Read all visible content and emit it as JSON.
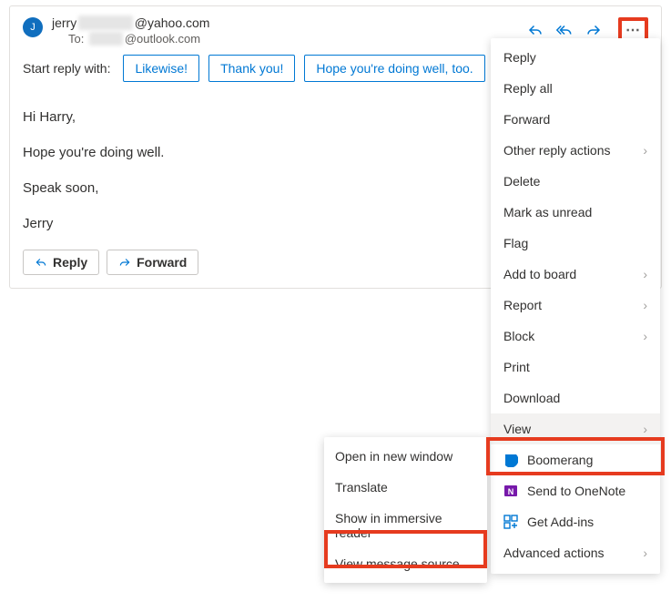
{
  "sender": {
    "avatar_initial": "J",
    "name_prefix": "jerry",
    "name_blur": "██████",
    "domain": "@yahoo.com",
    "to_label": "To:",
    "to_blur": "████",
    "to_domain": "@outlook.com"
  },
  "quick_reply": {
    "label": "Start reply with:",
    "options": [
      "Likewise!",
      "Thank you!",
      "Hope you're doing well, too."
    ]
  },
  "body": {
    "line1": "Hi Harry,",
    "line2": "Hope you're doing well.",
    "line3": "Speak soon,",
    "line4": "Jerry"
  },
  "bottom_buttons": {
    "reply": "Reply",
    "forward": "Forward"
  },
  "menu": {
    "reply": "Reply",
    "reply_all": "Reply all",
    "forward": "Forward",
    "other_reply": "Other reply actions",
    "delete": "Delete",
    "mark_unread": "Mark as unread",
    "flag": "Flag",
    "add_board": "Add to board",
    "report": "Report",
    "block": "Block",
    "print": "Print",
    "download": "Download",
    "view": "View",
    "boomerang": "Boomerang",
    "onenote": "Send to OneNote",
    "addins": "Get Add-ins",
    "advanced": "Advanced actions"
  },
  "submenu": {
    "new_window": "Open in new window",
    "translate": "Translate",
    "immersive": "Show in immersive reader",
    "source": "View message source"
  }
}
